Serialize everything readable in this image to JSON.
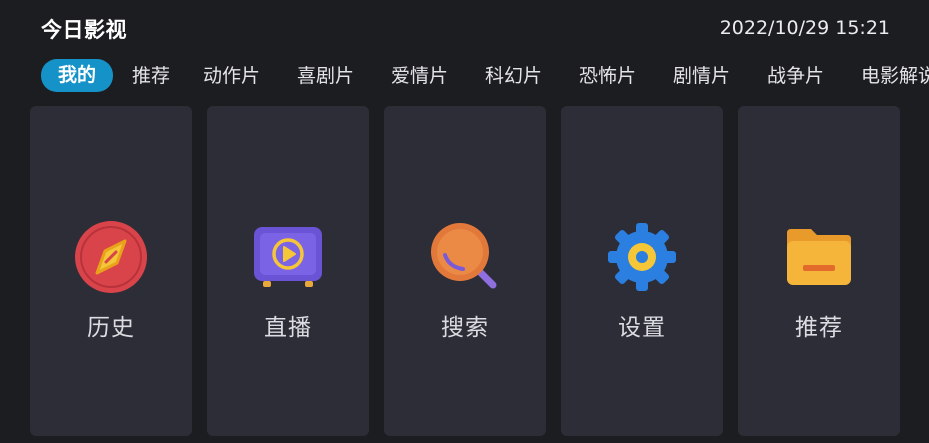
{
  "header": {
    "app_title": "今日影视",
    "datetime": "2022/10/29 15:21"
  },
  "tabs": [
    {
      "label": "我的",
      "active": true
    },
    {
      "label": "推荐"
    },
    {
      "label": "动作片"
    },
    {
      "label": "喜剧片"
    },
    {
      "label": "爱情片"
    },
    {
      "label": "科幻片"
    },
    {
      "label": "恐怖片"
    },
    {
      "label": "剧情片"
    },
    {
      "label": "战争片"
    },
    {
      "label": "电影解说"
    }
  ],
  "cards": [
    {
      "label": "历史",
      "icon": "compass-icon",
      "color": "#d9434a"
    },
    {
      "label": "直播",
      "icon": "tv-play-icon",
      "color": "#6b53d6"
    },
    {
      "label": "搜索",
      "icon": "magnifier-icon",
      "color": "#e2783a"
    },
    {
      "label": "设置",
      "icon": "gear-icon",
      "color": "#2a7fe0"
    },
    {
      "label": "推荐",
      "icon": "folder-icon",
      "color": "#f2b137"
    }
  ],
  "colors": {
    "background": "#1c1d21",
    "card": "#2c2d36",
    "accent": "#1592c7"
  }
}
